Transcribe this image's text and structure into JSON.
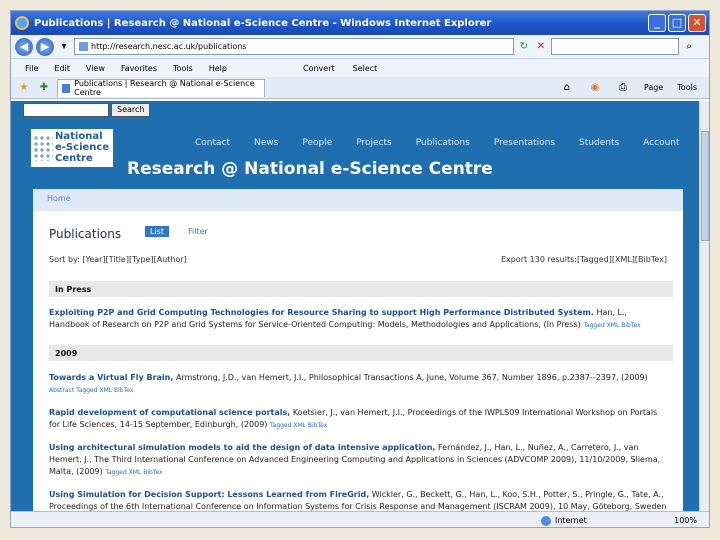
{
  "window": {
    "title": "Publications | Research @ National e-Science Centre - Windows Internet Explorer",
    "minimize": "_",
    "maximize": "□",
    "close": "✕"
  },
  "address": {
    "url": "http://research.nesc.ac.uk/publications"
  },
  "menu": {
    "items": [
      "File",
      "Edit",
      "View",
      "Favorites",
      "Tools",
      "Help"
    ],
    "links": [
      "Convert",
      "Select"
    ]
  },
  "tab": {
    "label": "Publications | Research @ National e-Science Centre"
  },
  "tools": [
    "Page",
    "Tools"
  ],
  "site": {
    "search_button": "Search",
    "logo": [
      "National",
      "e-Science",
      "Centre"
    ],
    "title": "Research @ National e-Science Centre",
    "nav": [
      "Contact",
      "News",
      "People",
      "Projects",
      "Publications",
      "Presentations",
      "Students",
      "Account"
    ],
    "breadcrumb": "Home"
  },
  "publications": {
    "heading": "Publications",
    "tab_list": "List",
    "tab_filter": "Filter",
    "sort_by": "Sort by: [Year][Title][Type][Author]",
    "export": "Export 130 results:[Tagged][XML][BibTex]",
    "sections": {
      "in_press": "In Press",
      "y2009": "2009"
    },
    "entries": [
      {
        "title": "Exploiting P2P and Grid Computing Technologies for Resource Sharing to support High Performance Distributed System.",
        "rest": "Han, L., Handbook of Research on P2P and Grid Systems for Service-Oriented Computing: Models, Methodologies and Applications, (In Press)",
        "links": "Tagged XML BibTex"
      },
      {
        "title": "Towards a Virtual Fly Brain,",
        "rest": "Armstrong, J.D., van Hemert, J.I., Philosophical Transactions A, June, Volume 367, Number 1896, p.2387--2397, (2009)",
        "links": "Abstract Tagged XML BibTex"
      },
      {
        "title": "Rapid development of computational science portals,",
        "rest": "Koetsier, J., van Hemert, J.I., Proceedings of the IWPLS09 International Workshop on Portals for Life Sciences, 14-15 September, Edinburgh, (2009)",
        "links": "Tagged XML BibTex"
      },
      {
        "title": "Using architectural simulation models to aid the design of data intensive application,",
        "rest": "Fernández, J., Han, L., Nuñez, A., Carretero, J., van Hemert, J., The Third International Conference on Advanced Engineering Computing and Applications in Sciences (ADVCOMP 2009), 11/10/2009, Sliema, Malta, (2009)",
        "links": "Tagged XML BibTex"
      },
      {
        "title": "Using Simulation for Decision Support: Lessons Learned from FireGrid,",
        "rest": "Wickler, G., Beckett, G., Han, L., Koo, S.H., Potter, S., Pringle, G., Tate, A., Proceedings of the 6th International Conference on Information Systems for Crisis Response and Management (ISCRAM 2009), 10 May, Göteborg, Sweden",
        "links": ""
      }
    ]
  },
  "status": {
    "zone": "Internet",
    "zoom": "100%"
  }
}
